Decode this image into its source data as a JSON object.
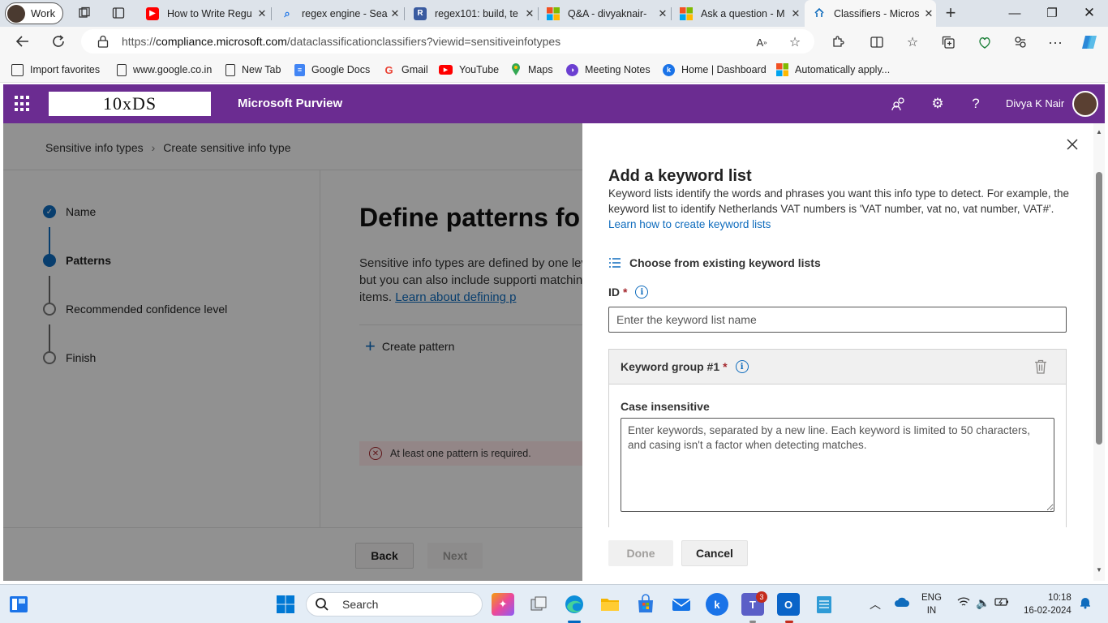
{
  "browser": {
    "profile_label": "Work",
    "tabs": [
      {
        "title": "How to Write Regu",
        "favicon": "youtube-icon",
        "color": "#ff0000"
      },
      {
        "title": "regex engine - Sea",
        "favicon": "bing-search-icon",
        "color": "#1a73e8"
      },
      {
        "title": "regex101: build, te",
        "favicon": "regex101-icon",
        "color": "#3a5ba0"
      },
      {
        "title": "Q&A - divyaknair-",
        "favicon": "microsoft-icon",
        "color": "#f25022"
      },
      {
        "title": "Ask a question - M",
        "favicon": "microsoft-icon",
        "color": "#f25022"
      },
      {
        "title": "Classifiers - Micros",
        "favicon": "purview-icon",
        "color": "#0f6cbd"
      }
    ],
    "url_prefix": "https://",
    "url_domain": "compliance.microsoft.com",
    "url_path": "/dataclassificationclassifiers?viewid=sensitiveinfotypes",
    "favorites": [
      {
        "label": "Import favorites",
        "icon": "import-icon"
      },
      {
        "label": "www.google.co.in",
        "icon": "page-icon"
      },
      {
        "label": "New Tab",
        "icon": "page-icon"
      },
      {
        "label": "Google Docs",
        "icon": "docs-icon"
      },
      {
        "label": "Gmail",
        "icon": "google-icon"
      },
      {
        "label": "YouTube",
        "icon": "youtube-icon"
      },
      {
        "label": "Maps",
        "icon": "maps-icon"
      },
      {
        "label": "Meeting Notes",
        "icon": "notes-icon"
      },
      {
        "label": "Home | Dashboard",
        "icon": "k-icon"
      },
      {
        "label": "Automatically apply...",
        "icon": "microsoft-icon"
      }
    ]
  },
  "header": {
    "logo_text": "10xDS",
    "app_name": "Microsoft Purview",
    "user_name": "Divya K Nair",
    "brand_color": "#6b2c91"
  },
  "wizard": {
    "breadcrumb": [
      "Sensitive info types",
      "Create sensitive info type"
    ],
    "steps": [
      {
        "label": "Name",
        "state": "done"
      },
      {
        "label": "Patterns",
        "state": "current"
      },
      {
        "label": "Recommended confidence level",
        "state": "todo"
      },
      {
        "label": "Finish",
        "state": "todo"
      }
    ],
    "heading": "Define patterns fo",
    "description": "Sensitive info types are defined by one level, but you can also include supporti matching items.",
    "learn_link": "Learn about defining p",
    "create_pattern": "Create pattern",
    "error": "At least one pattern is required.",
    "back": "Back",
    "next": "Next"
  },
  "panel": {
    "title": "Add a keyword list",
    "description": "Keyword lists identify the words and phrases you want this info type to detect. For example, the keyword list to identify Netherlands VAT numbers is 'VAT number, vat no, vat number, VAT#'.",
    "learn_link": "Learn how to create keyword lists",
    "choose_existing": "Choose from existing keyword lists",
    "id_label": "ID",
    "required_mark": "*",
    "id_placeholder": "Enter the keyword list name",
    "group_label": "Keyword group #1",
    "case_label": "Case insensitive",
    "keywords_placeholder": "Enter keywords, separated by a new line. Each keyword is limited to 50 characters, and casing isn't a factor when detecting matches.",
    "done": "Done",
    "cancel": "Cancel",
    "accent_color": "#0f6cbd"
  },
  "taskbar": {
    "search_placeholder": "Search",
    "teams_badge": "3",
    "lang_1": "ENG",
    "lang_2": "IN",
    "time": "10:18",
    "date": "16-02-2024"
  }
}
